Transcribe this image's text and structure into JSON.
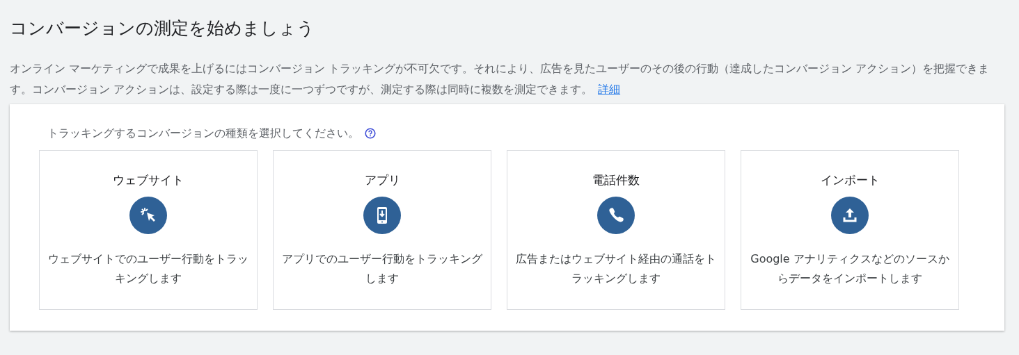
{
  "title": "コンバージョンの測定を始めましょう",
  "description": "オンライン マーケティングで成果を上げるにはコンバージョン トラッキングが不可欠です。それにより、広告を見たユーザーのその後の行動（達成したコンバージョン アクション）を把握できます。コンバージョン アクションは、設定する際は一度に一つずつですが、測定する際は同時に複数を測定できます。",
  "learn_more_link": "詳細",
  "prompt": "トラッキングするコンバージョンの種類を選択してください。",
  "options": [
    {
      "kind": "website",
      "title": "ウェブサイト",
      "description": "ウェブサイトでのユーザー行動をトラッキングします"
    },
    {
      "kind": "app",
      "title": "アプリ",
      "description": "アプリでのユーザー行動をトラッキングします"
    },
    {
      "kind": "phone",
      "title": "電話件数",
      "description": "広告またはウェブサイト経由の通話をトラッキングします"
    },
    {
      "kind": "import",
      "title": "インポート",
      "description": "Google アナリティクスなどのソースからデータをインポートします"
    }
  ]
}
